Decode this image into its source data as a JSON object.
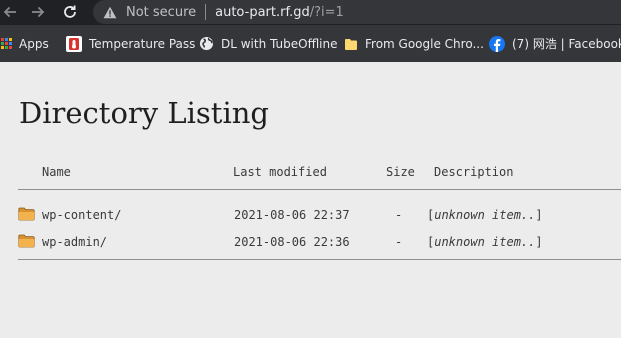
{
  "browser": {
    "security_text": "Not secure",
    "url_host": "auto-part.rf.gd",
    "url_path": "/?i=1"
  },
  "bookmarks": [
    {
      "label": "Apps",
      "icon": "apps-grid-icon"
    },
    {
      "label": "Temperature Pass",
      "icon": "temperature-pass-favicon"
    },
    {
      "label": "DL with TubeOffline",
      "icon": "globe-icon"
    },
    {
      "label": "From Google Chro...",
      "icon": "folder-icon"
    },
    {
      "label": "(7) 网浩 | Facebook",
      "icon": "facebook-icon"
    }
  ],
  "page": {
    "title": "Directory Listing",
    "columns": {
      "name": "Name",
      "modified": "Last modified",
      "size": "Size",
      "description": "Description"
    },
    "entries": [
      {
        "name": "wp-content/",
        "modified": "2021-08-06 22:37",
        "size": "-",
        "description": "unknown item..",
        "icon": "folder-icon"
      },
      {
        "name": "wp-admin/",
        "modified": "2021-08-06 22:36",
        "size": "-",
        "description": "unknown item..",
        "icon": "folder-icon"
      }
    ]
  },
  "colors": {
    "toolbar_bg": "#202124",
    "bookmarks_bg": "#35363a",
    "page_bg": "#ececec",
    "folder": "#e8a33a",
    "facebook": "#1877f2"
  }
}
